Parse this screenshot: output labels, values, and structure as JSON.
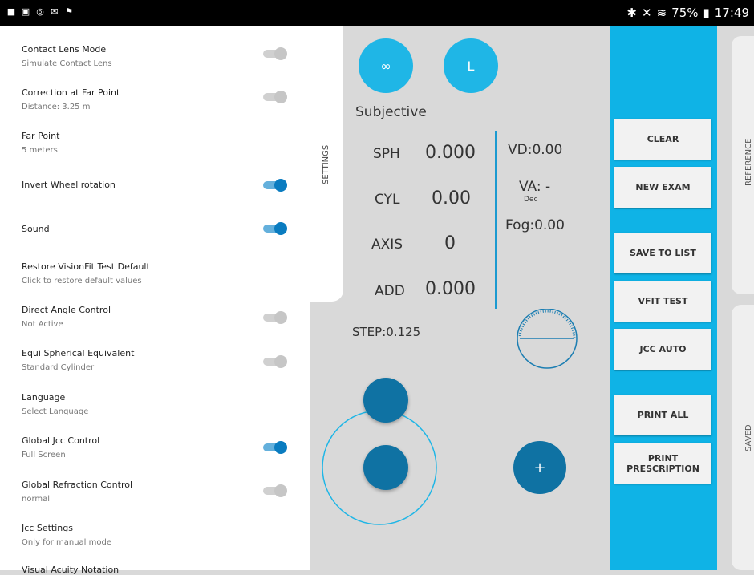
{
  "statusbar": {
    "left_icons": [
      "video-icon",
      "gallery-icon",
      "location-icon",
      "mail-icon",
      "flag-icon"
    ],
    "right_text": "75%",
    "time": "17:49"
  },
  "top_buttons": {
    "infinity": "∞",
    "left": "L"
  },
  "subjective": "Subjective",
  "values": {
    "sph_label": "SPH",
    "sph_value": "0.000",
    "cyl_label": "CYL",
    "cyl_value": "0.00",
    "axis_label": "AXIS",
    "axis_value": "0",
    "add_label": "ADD",
    "add_value": "0.000",
    "vd": "VD:0.00",
    "va": "VA: -",
    "va_sub": "Dec",
    "fog": "Fog:0.00",
    "step": "STEP:0.125"
  },
  "plus_label": "+",
  "side_buttons": {
    "clear": "CLEAR",
    "new_exam": "NEW EXAM",
    "save_to_list": "SAVE TO LIST",
    "vfit_test": "VFIT TEST",
    "jcc_auto": "JCC AUTO",
    "print_all": "PRINT ALL",
    "print_prescription": "PRINT PRESCRIPTION"
  },
  "rails": {
    "reference": "REFERENCE",
    "saved": "SAVED"
  },
  "settings": {
    "tab_label": "SETTINGS",
    "items": [
      {
        "title": "Contact Lens Mode",
        "subtitle": "Simulate Contact Lens",
        "toggle": "off"
      },
      {
        "title": "Correction at Far Point",
        "subtitle": "Distance: 3.25 m",
        "toggle": "off"
      },
      {
        "title": "Far Point",
        "subtitle": "5 meters"
      },
      {
        "title": "Invert Wheel rotation",
        "subtitle": "",
        "toggle": "on"
      },
      {
        "title": "Sound",
        "subtitle": "",
        "toggle": "on"
      },
      {
        "title": "Restore VisionFit Test Default",
        "subtitle": "Click to restore default values"
      },
      {
        "title": "Direct Angle Control",
        "subtitle": "Not Active",
        "toggle": "off"
      },
      {
        "title": "Equi Spherical Equivalent",
        "subtitle": "Standard Cylinder",
        "toggle": "off"
      },
      {
        "title": "Language",
        "subtitle": "Select Language"
      },
      {
        "title": "Global Jcc Control",
        "subtitle": "Full Screen",
        "toggle": "on"
      },
      {
        "title": "Global Refraction Control",
        "subtitle": "normal",
        "toggle": "off"
      },
      {
        "title": "Jcc Settings",
        "subtitle": "Only for manual mode"
      },
      {
        "title": "Visual Acuity Notation",
        "subtitle": ""
      }
    ]
  },
  "colors": {
    "accent": "#0fb3e6",
    "dark_blue": "#0f72a3"
  }
}
